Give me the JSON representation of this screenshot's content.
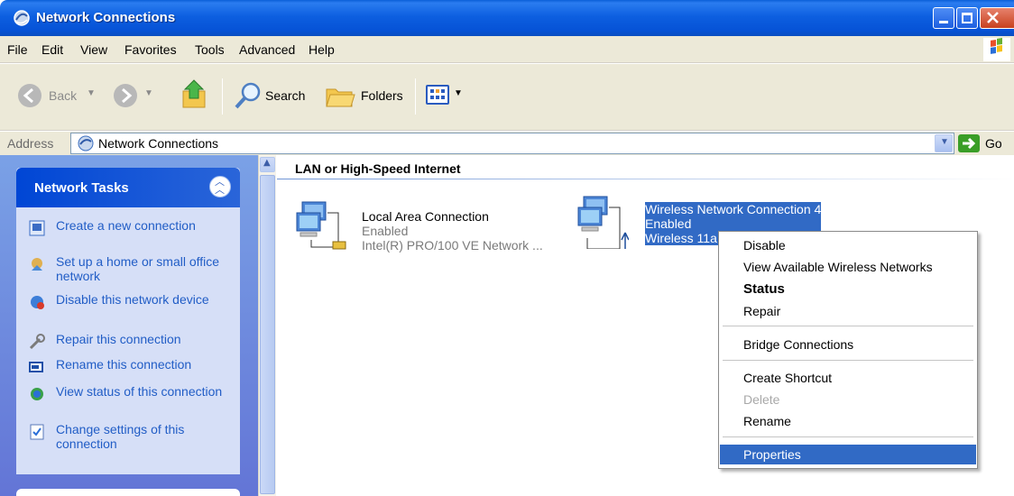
{
  "window": {
    "title": "Network Connections"
  },
  "menubar": {
    "items": [
      "File",
      "Edit",
      "View",
      "Favorites",
      "Tools",
      "Advanced",
      "Help"
    ]
  },
  "toolbar": {
    "back_label": "Back",
    "search_label": "Search",
    "folders_label": "Folders"
  },
  "address": {
    "label": "Address",
    "value": "Network Connections",
    "go_label": "Go"
  },
  "tasks": {
    "title": "Network Tasks",
    "items": [
      {
        "label": "Create a new connection",
        "icon": "new-connection-icon"
      },
      {
        "label": "Set up a home or small office network",
        "icon": "home-network-icon"
      },
      {
        "label": "Disable this network device",
        "icon": "disable-device-icon"
      },
      {
        "label": "Repair this connection",
        "icon": "repair-icon"
      },
      {
        "label": "Rename this connection",
        "icon": "rename-icon"
      },
      {
        "label": "View status of this connection",
        "icon": "status-icon"
      },
      {
        "label": "Change settings of this connection",
        "icon": "settings-icon"
      }
    ]
  },
  "content": {
    "group_title": "LAN or High-Speed Internet",
    "connections": [
      {
        "name": "Local Area Connection",
        "status": "Enabled",
        "device": "Intel(R) PRO/100 VE Network ..."
      },
      {
        "name": "Wireless Network Connection 4",
        "status": "Enabled",
        "device": "Wireless 11a"
      }
    ]
  },
  "context_menu": {
    "items": [
      {
        "label": "Disable"
      },
      {
        "label": "View Available Wireless Networks"
      },
      {
        "label": "Status"
      },
      {
        "label": "Repair"
      },
      {
        "label": "Bridge Connections"
      },
      {
        "label": "Create Shortcut"
      },
      {
        "label": "Delete"
      },
      {
        "label": "Rename"
      },
      {
        "label": "Properties"
      }
    ]
  },
  "colors": {
    "titlebar": "#0a5fd8",
    "selection": "#316ac5",
    "task_link": "#215dc6",
    "task_pane": "#d6dff7"
  }
}
